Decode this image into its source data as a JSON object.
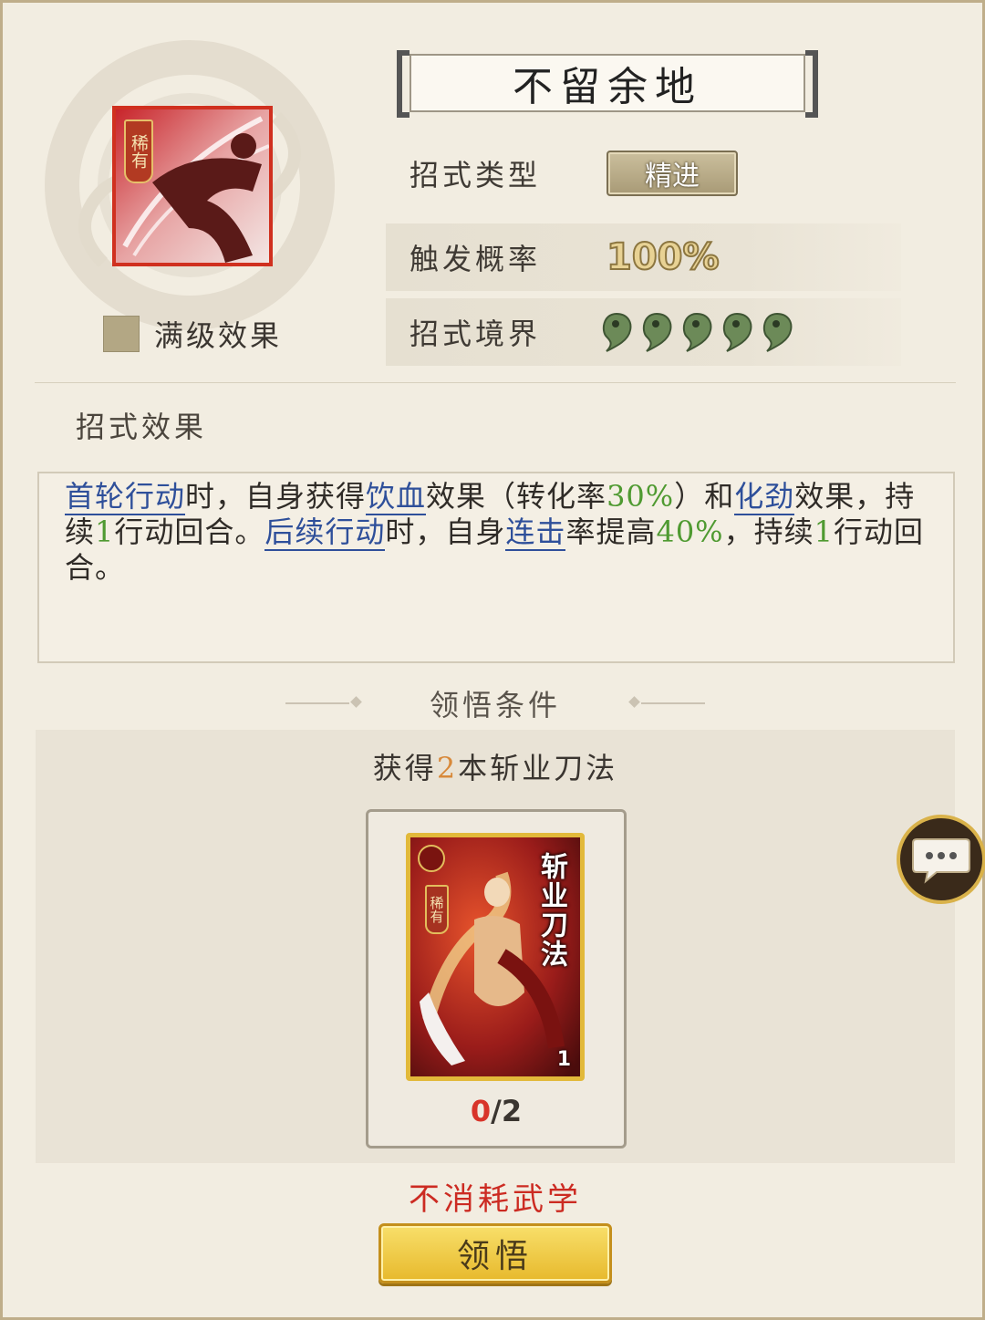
{
  "skill": {
    "title": "不留余地",
    "rarity_tag": "稀有",
    "max_level_label": "满级效果"
  },
  "props": {
    "type_label": "招式类型",
    "type_value": "精进",
    "trigger_label": "触发概率",
    "trigger_value": "100%",
    "realm_label": "招式境界",
    "realm_level": 5
  },
  "effect": {
    "section_label": "招式效果",
    "segments": [
      {
        "t": "首轮行动",
        "k": "kw"
      },
      {
        "t": "时，自身获得"
      },
      {
        "t": "饮血",
        "k": "kw"
      },
      {
        "t": "效果（转化率"
      },
      {
        "t": "30%",
        "k": "num"
      },
      {
        "t": "）和"
      },
      {
        "t": "化劲",
        "k": "kw"
      },
      {
        "t": "效果，持续"
      },
      {
        "t": "1",
        "k": "num"
      },
      {
        "t": "行动回合。"
      },
      {
        "t": "后续行动",
        "k": "kw"
      },
      {
        "t": "时，自身"
      },
      {
        "t": "连击",
        "k": "kw"
      },
      {
        "t": "率提高"
      },
      {
        "t": "40%",
        "k": "num"
      },
      {
        "t": "，持续"
      },
      {
        "t": "1",
        "k": "num"
      },
      {
        "t": "行动回合。"
      }
    ]
  },
  "condition": {
    "title": "领悟条件",
    "req_prefix": "获得",
    "req_count": "2",
    "req_suffix": "本斩业刀法",
    "card_name": "斩业刀法",
    "card_rarity": "稀有",
    "card_count": "1",
    "progress_current": "0",
    "progress_total": "/2"
  },
  "footer": {
    "no_consume": "不消耗武学",
    "comprehend_button": "领悟"
  },
  "colors": {
    "keyword": "#2e4f9a",
    "number": "#4f9a31",
    "warning": "#cc2b22"
  }
}
